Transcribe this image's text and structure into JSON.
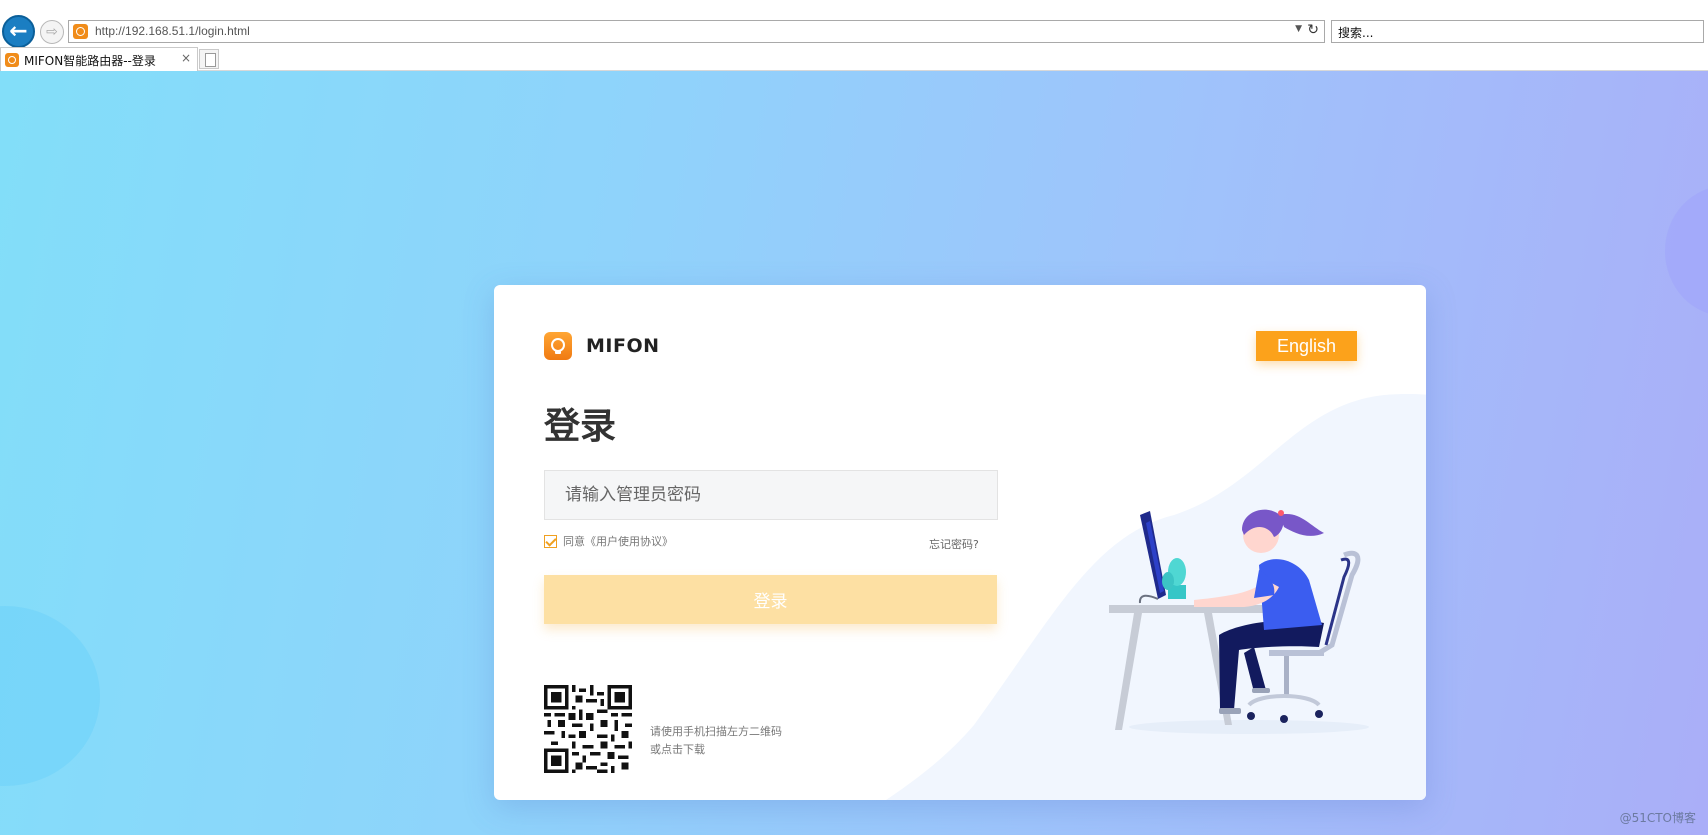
{
  "browser": {
    "url": "http://192.168.51.1/login.html",
    "search_placeholder": "搜索...",
    "tab_title": "MIFON智能路由器--登录",
    "tab_close": "×"
  },
  "card": {
    "brand_name": "MIFON",
    "lang_button": "English",
    "title": "登录",
    "password_placeholder": "请输入管理员密码",
    "agree_text": "同意《用户使用协议》",
    "agree_checked": true,
    "forgot_link": "忘记密码?",
    "login_button": "登录",
    "qr_line1": "请使用手机扫描左方二维码",
    "qr_line2": "或点击下载"
  },
  "watermark": "@51CTO博客",
  "colors": {
    "accent": "#fca21b",
    "login_button": "#fde0a3",
    "brand_orange": "#f08c1a",
    "background_start": "#82def9",
    "background_end": "#aaaef8"
  }
}
